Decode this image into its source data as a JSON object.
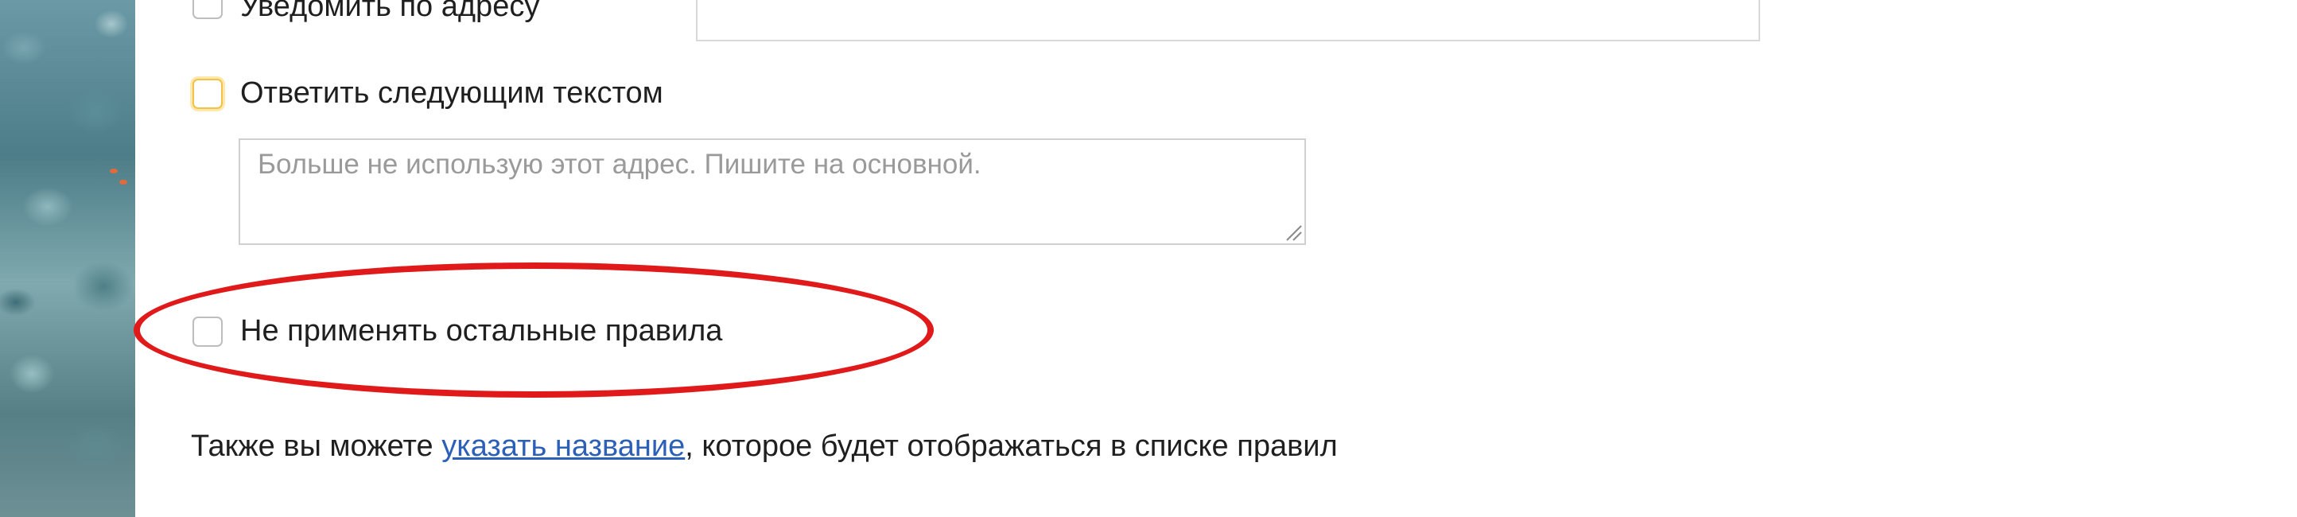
{
  "form": {
    "notify": {
      "label": "Уведомить по адресу",
      "checked": false,
      "input_value": ""
    },
    "reply": {
      "label": "Ответить следующим текстом",
      "checked": false,
      "focused": true,
      "textarea_placeholder": "Больше не использую этот адрес. Пишите на основной.",
      "textarea_value": ""
    },
    "stop_rules": {
      "label": "Не применять остальные правила",
      "checked": false
    },
    "footer": {
      "text_before": "Также вы можете ",
      "link_text": "указать название",
      "text_after": ", которое будет отображаться в списке правил"
    }
  },
  "annotation": {
    "shape": "ellipse",
    "color": "#e01a1a",
    "target": "stop_rules"
  },
  "colors": {
    "link": "#2b5fb8",
    "focus_outline": "#f2c14a",
    "checkbox_border": "#bdbdbd",
    "placeholder": "#9a9a9a"
  }
}
